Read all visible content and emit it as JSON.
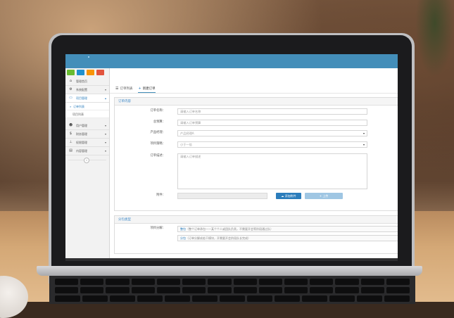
{
  "colors": {
    "topbar": "#438eb9",
    "accent": "#2b7dbc",
    "shortcut_green": "#68bc31",
    "shortcut_blue": "#2091cf",
    "shortcut_orange": "#f89406",
    "shortcut_red": "#e2543e"
  },
  "sidebar": {
    "items": [
      {
        "icon": "home-icon",
        "label": "管理首页"
      },
      {
        "icon": "gear-icon",
        "label": "系统配置",
        "arrow": "▾"
      },
      {
        "icon": "monitor-icon",
        "label": "项目管理",
        "arrow": "▴"
      },
      {
        "icon": "users-icon",
        "label": "用户管理",
        "arrow": "▾"
      },
      {
        "icon": "dollar-icon",
        "label": "财务管理",
        "arrow": "▾"
      },
      {
        "icon": "sitemap-icon",
        "label": "权限管理",
        "arrow": "▾"
      },
      {
        "icon": "newspaper-icon",
        "label": "内容管理",
        "arrow": "▾"
      }
    ],
    "subitems": [
      {
        "label": "订单列表",
        "bullet": "»"
      },
      {
        "label": "项目列表"
      }
    ],
    "collapse_icon": "«"
  },
  "tabs": [
    {
      "icon": "list-icon",
      "label": "订单列表"
    },
    {
      "icon": "plus-icon",
      "label": "新建订单"
    }
  ],
  "order_panel": {
    "title": "订单内容",
    "fields": {
      "name_label": "订单名称：",
      "name_placeholder": "请输入订单名称",
      "budget_label": "总预算：",
      "budget_placeholder": "请输入订单预算",
      "product_label": "产品经理：",
      "product_value": "产品经理A",
      "project_label": "项目策略：",
      "project_value": "小于一倍",
      "desc_label": "订单描述：",
      "desc_placeholder": "请输入订单描述",
      "attach_label": "附件：",
      "add_file": "添加附件",
      "upload": "上传"
    }
  },
  "split_panel": {
    "title": "分包类型",
    "label": "项目分解：",
    "options": [
      {
        "name": "整包",
        "desc": "（整个订单承包——某个个人或团队负责，不需要开会等阶段通过队）"
      },
      {
        "name": "分包",
        "desc": "（订单分解成若干模块，开需要开会阶段队长完成）"
      }
    ]
  }
}
